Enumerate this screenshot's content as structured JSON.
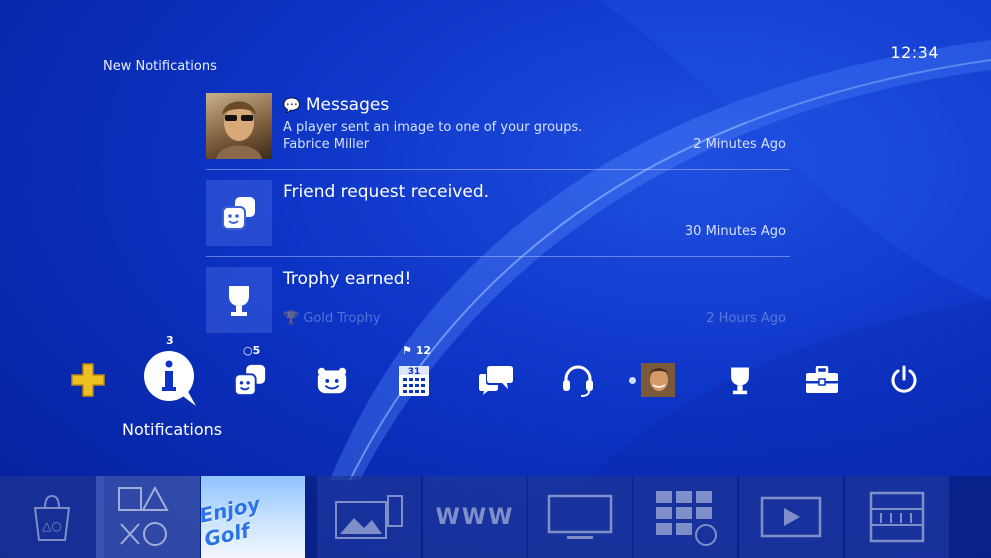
{
  "clock": "12:34",
  "section_title": "New Notifications",
  "notifications": [
    {
      "title": "Messages",
      "subtitle": "A player sent an image to one of your groups.",
      "sender": "Fabrice Miller",
      "time": "2 Minutes Ago",
      "icon": "messages-icon"
    },
    {
      "title": "Friend request received.",
      "subtitle": "",
      "sender": "",
      "time": "30 Minutes Ago",
      "icon": "friends-icon"
    },
    {
      "title": "Trophy earned!",
      "subtitle": "",
      "sender": "Gold Trophy",
      "time": "2 Hours Ago",
      "icon": "trophy-icon"
    }
  ],
  "toolbar": {
    "selected_label": "Notifications",
    "badges": {
      "notifications": "3",
      "friends": "5",
      "events": "12"
    },
    "items": [
      "playstation-plus-icon",
      "notifications-icon",
      "friends-icon",
      "party-icon",
      "events-icon",
      "messages-icon",
      "headset-icon",
      "profile-avatar",
      "trophy-icon",
      "settings-icon",
      "power-icon"
    ]
  },
  "shelf": {
    "game_title": "Enjoy Golf",
    "tiles": [
      "playstation-store-tile",
      "library-tile",
      "enjoy-golf-tile",
      "capture-gallery-tile",
      "internet-browser-tile",
      "tv-video-tile",
      "apps-tile",
      "video-player-tile",
      "library-shelf-tile"
    ]
  },
  "colors": {
    "background": "#0c33c4",
    "accent": "#ffffff",
    "plus_gold": "#f0c020"
  }
}
